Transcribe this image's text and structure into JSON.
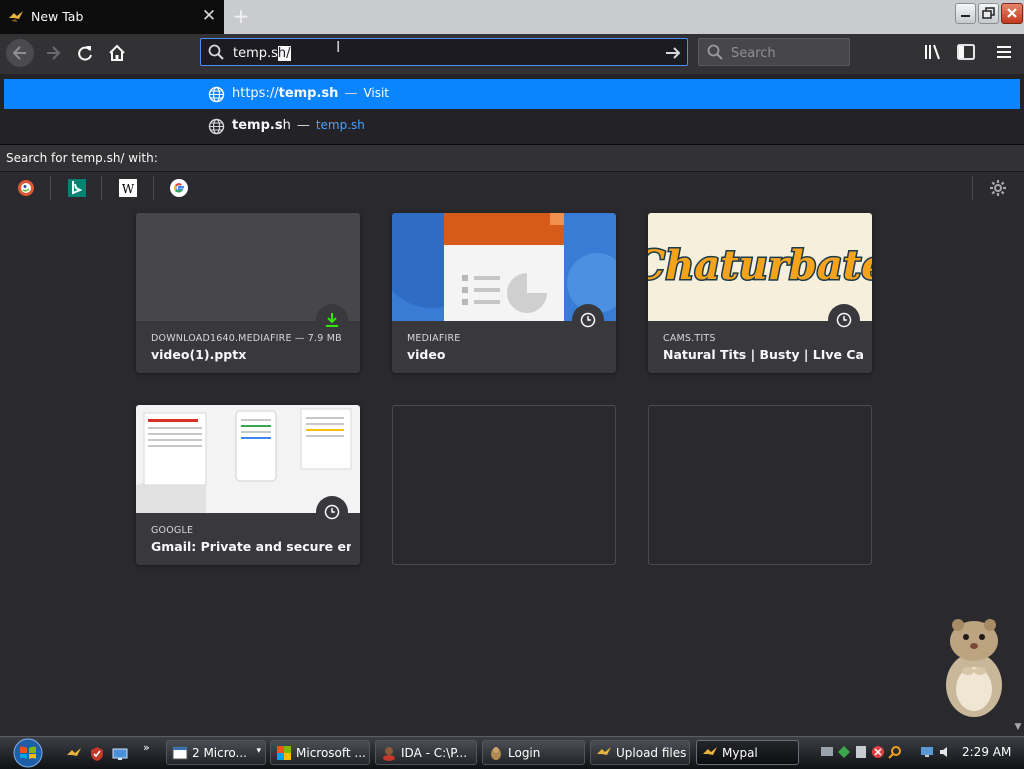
{
  "tab": {
    "title": "New Tab"
  },
  "urlbar": {
    "typed": "temp.s",
    "selected": "h/"
  },
  "searchbar": {
    "placeholder": "Search"
  },
  "suggestions": [
    {
      "prefix": "https://",
      "bold": "temp.s",
      "rest": "h",
      "separator": "—",
      "action": "Visit"
    },
    {
      "prefix": "",
      "bold": "temp.s",
      "rest": "h",
      "separator": "—",
      "url": "temp.sh"
    }
  ],
  "search_for": "Search for temp.sh/ with:",
  "engines": [
    "duckduckgo-icon",
    "bing-icon",
    "wikipedia-icon",
    "google-icon"
  ],
  "top_sites": [
    {
      "host": "DOWNLOAD1640.MEDIAFIRE — 7.9 MB",
      "title": "video(1).pptx",
      "badge": "download"
    },
    {
      "host": "MEDIAFIRE",
      "title": "video",
      "badge": "history"
    },
    {
      "host": "CAMS.TITS",
      "title": "Natural Tits | Busty | LIve Cams| ...",
      "badge": "history",
      "logo_text": "Chaturbate"
    },
    {
      "host": "GOOGLE",
      "title": "Gmail: Private and secure email ...",
      "badge": "history"
    }
  ],
  "taskbar": {
    "buttons": [
      {
        "label": "2 Micro...",
        "icon": "window-icon"
      },
      {
        "label": "Microsoft ...",
        "icon": "ms-office-icon"
      },
      {
        "label": "IDA - C:\\P...",
        "icon": "ida-icon"
      },
      {
        "label": "Login",
        "icon": "app-icon"
      },
      {
        "label": "Upload files",
        "icon": "mypal-icon"
      },
      {
        "label": "Mypal",
        "icon": "mypal-icon"
      }
    ],
    "clock": "2:29 AM"
  },
  "colors": {
    "accent": "#0a84ff",
    "toolbar": "#323234",
    "content": "#2a2a2e"
  }
}
